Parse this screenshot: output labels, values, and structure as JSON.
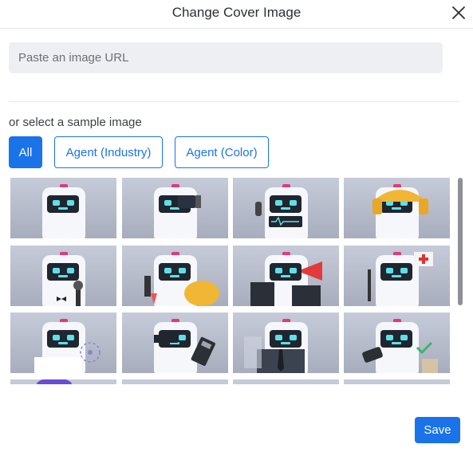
{
  "dialog": {
    "title": "Change Cover Image",
    "url_placeholder": "Paste an image URL",
    "url_value": "",
    "sample_label": "or select a sample image",
    "tabs": [
      {
        "label": "All",
        "active": true
      },
      {
        "label": "Agent (Industry)",
        "active": false
      },
      {
        "label": "Agent (Color)",
        "active": false
      }
    ],
    "save_label": "Save"
  },
  "colors": {
    "accent": "#1a73e8",
    "input_bg": "#eeeff2",
    "thumb_bg": "#b7bccb"
  },
  "samples": [
    {
      "accessory": "none"
    },
    {
      "accessory": "tablet"
    },
    {
      "accessory": "pulse-monitor"
    },
    {
      "accessory": "hard-hat"
    },
    {
      "accessory": "microphone"
    },
    {
      "accessory": "yellow-helmet"
    },
    {
      "accessory": "megaphone"
    },
    {
      "accessory": "medical-cross"
    },
    {
      "accessory": "atom-sparkles"
    },
    {
      "accessory": "calculator"
    },
    {
      "accessory": "suit-tie"
    },
    {
      "accessory": "checkmark-box"
    },
    {
      "accessory": "purple-partial"
    },
    {
      "accessory": "partial"
    },
    {
      "accessory": "partial"
    },
    {
      "accessory": "partial"
    }
  ]
}
